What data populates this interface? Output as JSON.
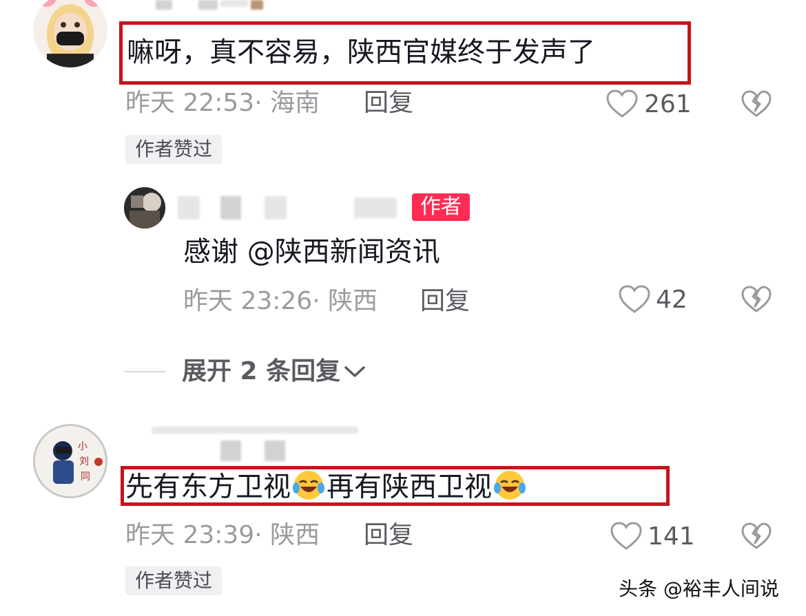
{
  "comments": [
    {
      "text": "嘛呀，真不容易，陕西官媒终于发声了",
      "time": "昨天 22:53",
      "location": "· 海南",
      "reply_label": "回复",
      "likes": "261",
      "badge": "作者赞过"
    },
    {
      "author_badge": "作者",
      "text": "感谢 @陕西新闻资讯",
      "time": "昨天 23:26",
      "location": "· 陕西",
      "reply_label": "回复",
      "likes": "42"
    },
    {
      "text_part1": "先有东方卫视",
      "text_part2": "再有陕西卫视",
      "time": "昨天 23:39",
      "location": "· 陕西",
      "reply_label": "回复",
      "likes": "141",
      "badge": "作者赞过"
    }
  ],
  "expand_replies": "展开 2 条回复",
  "watermark": "头条 @裕丰人间说",
  "icons": {
    "like": "heart-outline-icon",
    "dislike": "broken-heart-icon",
    "expand": "chevron-down-icon",
    "emoji": "rolling-laughing-emoji"
  },
  "colors": {
    "highlight_border": "#c3161c",
    "author_badge": "#fe2c55",
    "meta_text": "#9a9ba0"
  }
}
